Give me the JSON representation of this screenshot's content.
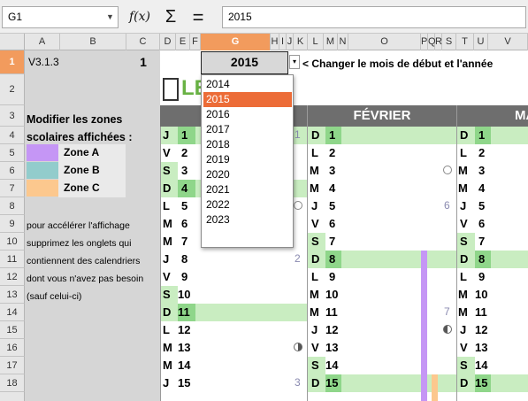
{
  "formula_bar": {
    "name_box": "G1",
    "fx_label": "f(x)",
    "sum_label": "Σ",
    "equals_label": "=",
    "input_value": "2015"
  },
  "columns": [
    "A",
    "B",
    "C",
    "D",
    "E",
    "F",
    "G",
    "H",
    "I",
    "J",
    "K",
    "L",
    "M",
    "N",
    "O",
    "P",
    "Q",
    "R",
    "S",
    "T",
    "U",
    "V"
  ],
  "rows": [
    "1",
    "2",
    "3",
    "4",
    "5",
    "6",
    "7",
    "8",
    "9",
    "10",
    "11",
    "12",
    "13",
    "14",
    "15",
    "16",
    "17",
    "18"
  ],
  "sheet": {
    "version": "V3.1.3",
    "c1_value": "1",
    "year_value": "2015",
    "year_hint": "< Changer le mois de début et l'année",
    "logo_text": "LE",
    "zones_title_1": "Modifier les zones",
    "zones_title_2": "scolaires affichées :",
    "zones": [
      {
        "label": "Zone A",
        "color": "#c596f5"
      },
      {
        "label": "Zone B",
        "color": "#92cccc"
      },
      {
        "label": "Zone C",
        "color": "#fcc88e"
      }
    ],
    "note_lines": [
      "pour accélérer l'affichage",
      "supprimez les onglets qui",
      "contiennent des calendriers",
      "dont vous n'avez pas besoin",
      "(sauf celui-ci)"
    ],
    "month_feb": "FÉVRIER",
    "month_mar_partial": "MA",
    "week_numbers": [
      "1",
      "6",
      "2",
      "7",
      "3"
    ]
  },
  "january": {
    "letters": [
      "J",
      "V",
      "S",
      "D",
      "L",
      "M",
      "M",
      "J",
      "V",
      "S",
      "D",
      "L",
      "M",
      "M",
      "J"
    ],
    "days": [
      "1",
      "2",
      "3",
      "4",
      "5",
      "6",
      "7",
      "8",
      "9",
      "10",
      "11",
      "12",
      "13",
      "14",
      "15"
    ]
  },
  "february": {
    "letters": [
      "D",
      "L",
      "M",
      "M",
      "J",
      "V",
      "S",
      "D",
      "L",
      "M",
      "M",
      "J",
      "V",
      "S",
      "D"
    ],
    "days": [
      "1",
      "2",
      "3",
      "4",
      "5",
      "6",
      "7",
      "8",
      "9",
      "10",
      "11",
      "12",
      "13",
      "14",
      "15"
    ]
  },
  "march": {
    "letters": [
      "D",
      "L",
      "M",
      "M",
      "J",
      "V",
      "S",
      "D",
      "L",
      "M",
      "M",
      "J",
      "V",
      "S",
      "D"
    ],
    "days": [
      "1",
      "2",
      "3",
      "4",
      "5",
      "6",
      "7",
      "8",
      "9",
      "10",
      "11",
      "12",
      "13",
      "14",
      "15"
    ]
  },
  "dropdown": {
    "options": [
      "2014",
      "2015",
      "2016",
      "2017",
      "2018",
      "2019",
      "2020",
      "2021",
      "2022",
      "2023"
    ],
    "selected": "2015"
  },
  "colors": {
    "weekend_green": "#b3e6a8",
    "day_green": "#8fd68a",
    "selection_orange": "#ec6c37",
    "header_gray": "#6e6e6e"
  }
}
